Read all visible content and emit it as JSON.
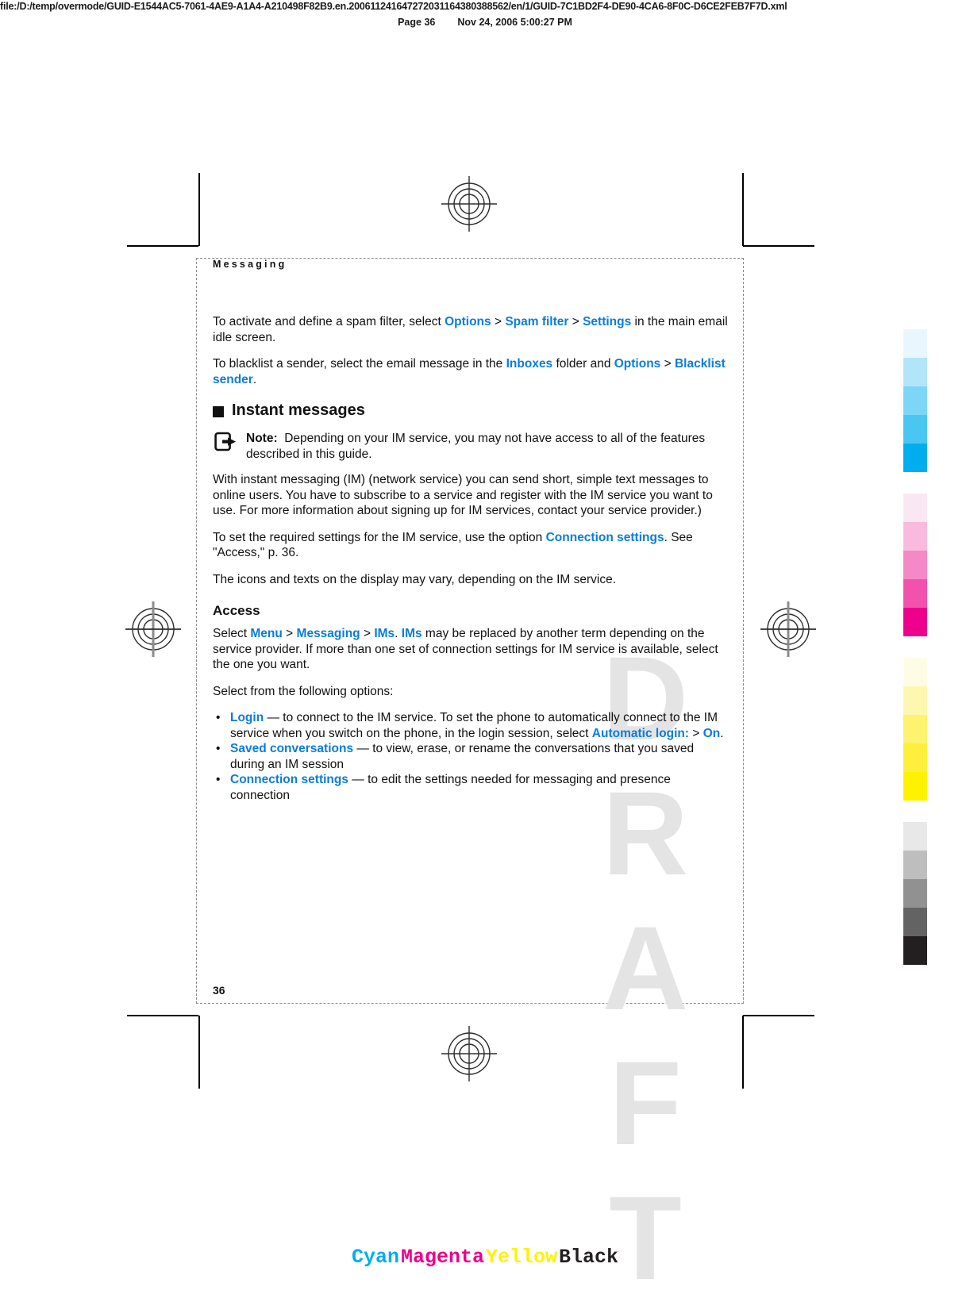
{
  "viewer": {
    "file_url": "file:/D:/temp/overmode/GUID-E1544AC5-7061-4AE9-A1A4-A210498F82B9.en.200611241647272031164380388562/en/1/GUID-7C1BD2F4-DE90-4CA6-8F0C-D6CE2FEB7F7D.xml",
    "page_label": "Page 36",
    "timestamp": "Nov 24, 2006 5:00:27 PM"
  },
  "page": {
    "running_head": "Messaging",
    "watermark": "DRAFT",
    "page_number": "36"
  },
  "content": {
    "para_spam_1": "To activate and define a spam filter, select ",
    "kw_options_1": "Options",
    "sep_1": " > ",
    "kw_spam_filter": "Spam filter",
    "sep_2": " > ",
    "kw_settings": "Settings",
    "para_spam_2": " in the main email idle screen.",
    "para_blacklist_1": "To blacklist a sender, select the email message in the ",
    "kw_inboxes": "Inboxes",
    "para_blacklist_2": " folder and ",
    "kw_options_2": "Options",
    "sep_3": " > ",
    "kw_blacklist_sender": "Blacklist sender",
    "para_blacklist_3": ".",
    "heading_instant_messages": "Instant messages",
    "note_label": "Note:",
    "note_body": "Depending on your IM service, you may not have access to all of the features described in this guide.",
    "para_with_im": "With instant messaging (IM) (network service) you can send short, simple text messages to online users. You have to subscribe to a service and register with the IM service you want to use. For more information about signing up for IM services, contact your service provider.)",
    "para_settings_1": "To set the required settings for the IM service, use the option ",
    "kw_connection_settings_1": "Connection settings",
    "para_settings_2": ". See \"Access,\" p. 36.",
    "para_icons_vary": "The icons and texts on the display may vary, depending on the IM service.",
    "heading_access": "Access",
    "para_access_1": "Select ",
    "kw_menu": "Menu",
    "sep_4": " > ",
    "kw_messaging": "Messaging",
    "sep_5": " > ",
    "kw_ims_1": "IMs",
    "para_access_2": ". ",
    "kw_ims_2": "IMs",
    "para_access_3": " may be replaced by another term depending on the service provider. If more than one set of connection settings for IM service is available, select the one you want.",
    "para_select_options": "Select from the following options:",
    "bullets": [
      {
        "keyword": "Login",
        "text_1": " — to connect to the IM service. To set the phone to automatically connect to the IM service when you switch on the phone, in the login session, select ",
        "keyword_2": "Automatic login:",
        "sep": " > ",
        "keyword_3": "On",
        "text_2": "."
      },
      {
        "keyword": "Saved conversations",
        "text_1": " — to view, erase, or rename the conversations that you saved during an IM session",
        "keyword_2": "",
        "sep": "",
        "keyword_3": "",
        "text_2": ""
      },
      {
        "keyword": "Connection settings",
        "text_1": " — to edit the settings needed for messaging and presence connection",
        "keyword_2": "",
        "sep": "",
        "keyword_3": "",
        "text_2": ""
      }
    ]
  },
  "colors": {
    "link_blue": "#0a7cdc",
    "cyan": "#00aeef",
    "magenta": "#ec008c",
    "yellow": "#fff200",
    "black": "#231f20"
  },
  "calibration": {
    "cyan_swatches": [
      "#e8f7fd",
      "#b3e5fa",
      "#7ed6f7",
      "#4ac6f3",
      "#00aeef"
    ],
    "magenta_swatches": [
      "#fbe7f3",
      "#f9bade",
      "#f489c6",
      "#f252ac",
      "#ec008c"
    ],
    "yellow_swatches": [
      "#fffce6",
      "#fdf7b0",
      "#fdf36e",
      "#fdef3c",
      "#fff200"
    ],
    "black_swatches": [
      "#e8e8e8",
      "#bebebe",
      "#919191",
      "#636363",
      "#231f20"
    ],
    "legend": [
      {
        "label": "Cyan",
        "color": "#00aeef"
      },
      {
        "label": "Magenta",
        "color": "#ec008c"
      },
      {
        "label": "Yellow",
        "color": "#fff200"
      },
      {
        "label": "Black",
        "color": "#231f20"
      }
    ]
  }
}
